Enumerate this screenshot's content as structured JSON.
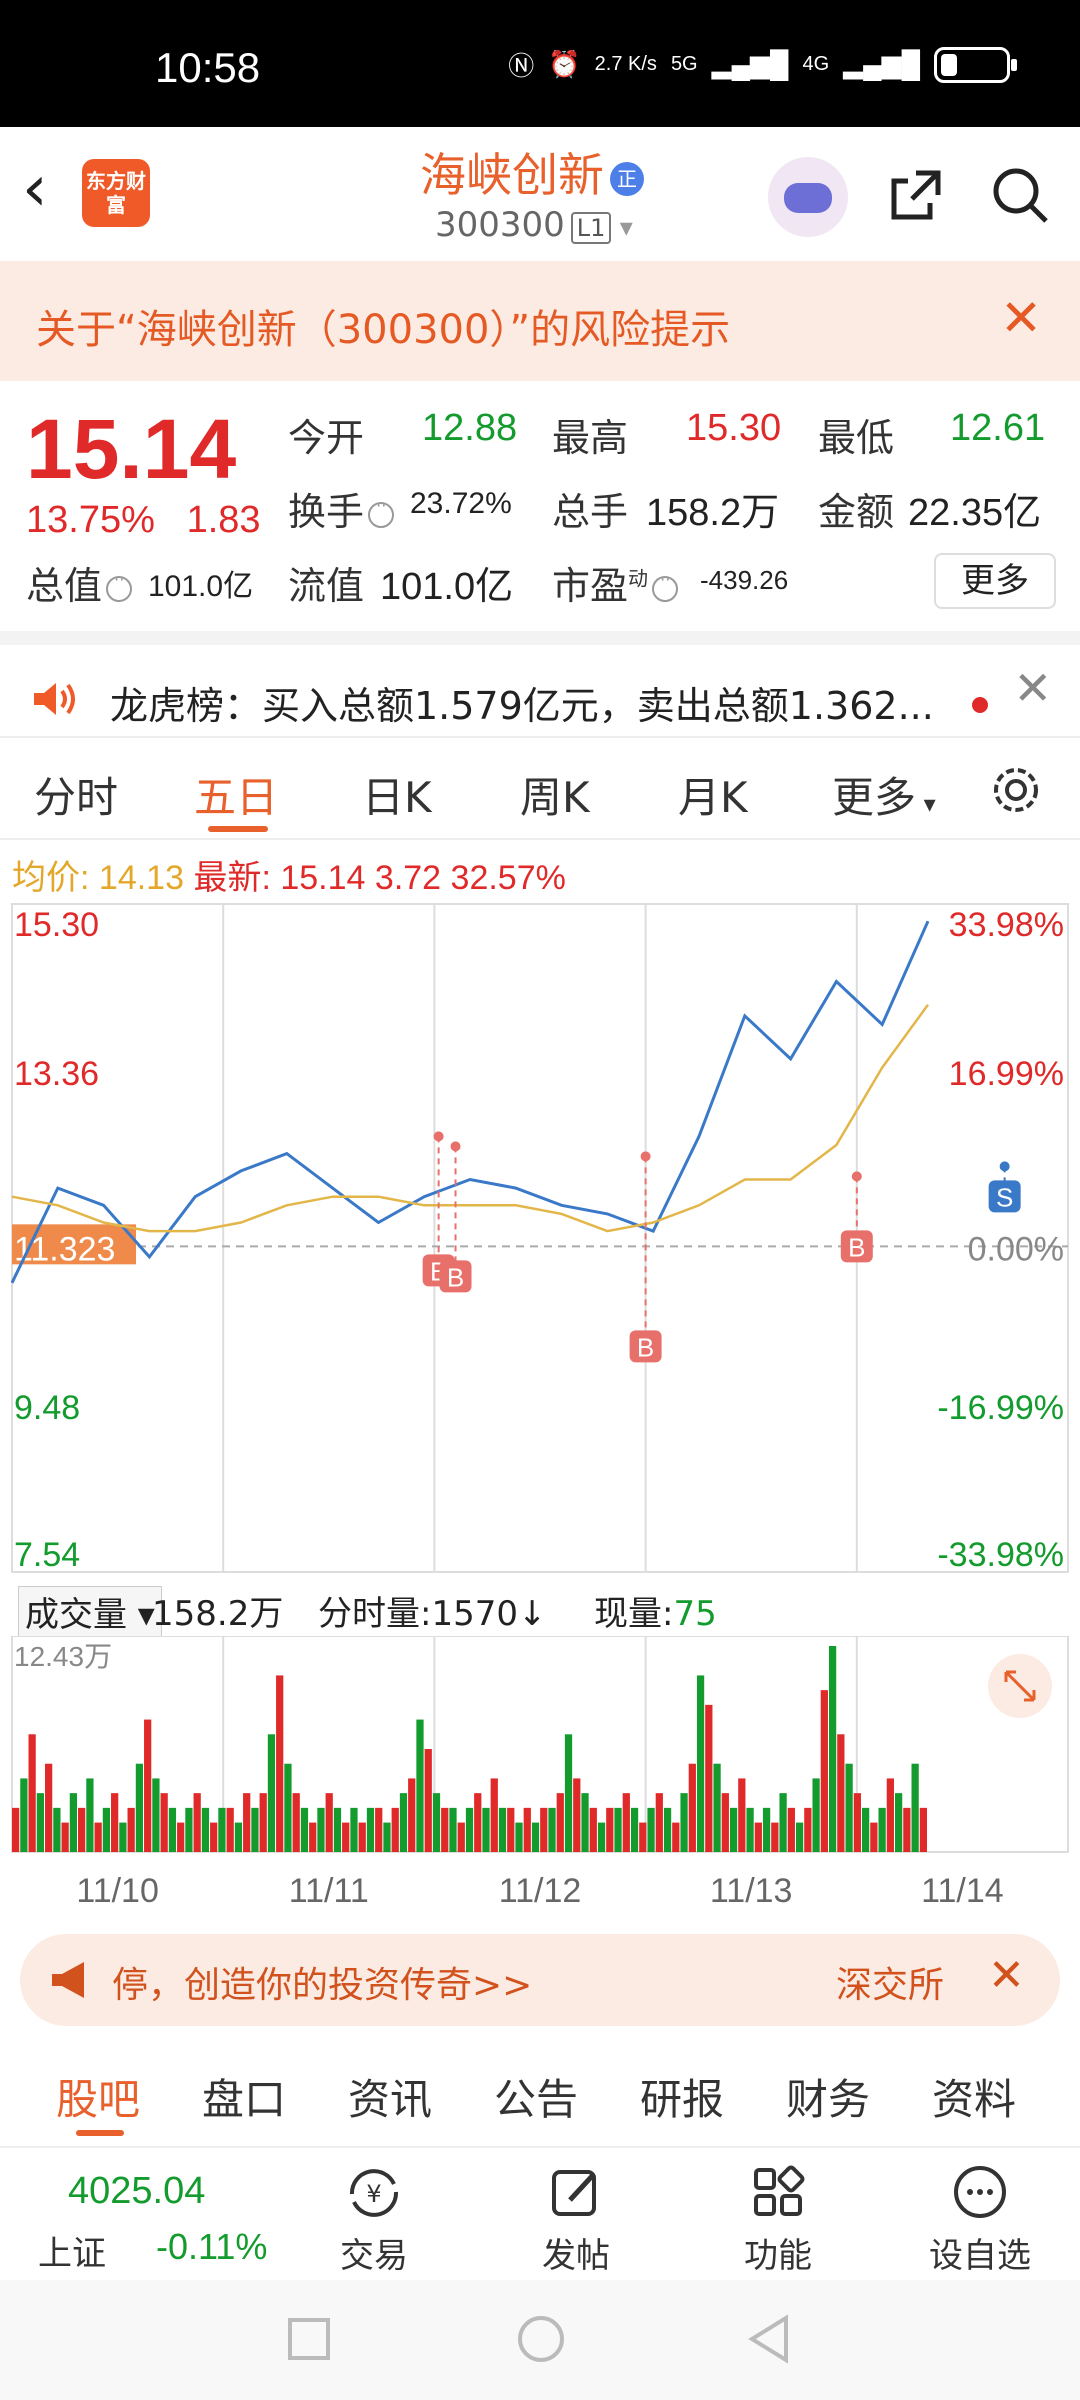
{
  "status_bar": {
    "time": "10:58",
    "net_speed": "2.7 K/s",
    "network1": "5G",
    "network2": "4G"
  },
  "header": {
    "logo_text": "东方财富",
    "stock_name": "海峡创新",
    "badge": "正",
    "stock_code": "300300",
    "level": "L1"
  },
  "risk_notice": {
    "text": "关于“海峡创新（300300）”的风险提示"
  },
  "quote": {
    "price": "15.14",
    "change_pct": "13.75%",
    "change_amt": "1.83",
    "open_label": "今开",
    "open_value": "12.88",
    "high_label": "最高",
    "high_value": "15.30",
    "low_label": "最低",
    "low_value": "12.61",
    "turnover_label": "换手",
    "turnover_value": "23.72%",
    "volume_label": "总手",
    "volume_value": "158.2万",
    "amount_label": "金额",
    "amount_value": "22.35亿",
    "mktcap_label": "总值",
    "mktcap_value": "101.0亿",
    "float_label": "流值",
    "float_value": "101.0亿",
    "pe_label": "市盈",
    "pe_sup": "动",
    "pe_value": "-439.26",
    "more_label": "更多"
  },
  "dragon_tiger": {
    "text": "龙虎榜：买入总额1.579亿元，卖出总额1.362..."
  },
  "chart_tabs": {
    "items": [
      "分时",
      "五日",
      "日K",
      "周K",
      "月K",
      "更多"
    ],
    "active": "五日"
  },
  "legend": {
    "avg_label": "均价:",
    "avg_value": "14.13",
    "latest_label": "最新:",
    "latest_value": "15.14",
    "chg_amt": "3.72",
    "chg_pct": "32.57%"
  },
  "chart_data": {
    "type": "line",
    "x": [
      "11/10",
      "11/11",
      "11/12",
      "11/13",
      "11/14"
    ],
    "y_left_ticks": [
      "15.30",
      "13.36",
      "11.323",
      "9.48",
      "7.54"
    ],
    "y_right_ticks": [
      "33.98%",
      "16.99%",
      "0.00%",
      "-16.99%",
      "-33.98%"
    ],
    "ylim": [
      7.54,
      15.3
    ],
    "base_price": 11.323,
    "series": [
      {
        "name": "最新",
        "values": [
          10.9,
          12.0,
          11.8,
          11.2,
          11.9,
          12.2,
          12.4,
          12.0,
          11.6,
          11.9,
          12.1,
          12.0,
          11.8,
          11.7,
          11.5,
          12.6,
          14.0,
          13.5,
          14.4,
          13.9,
          15.1
        ]
      },
      {
        "name": "均价",
        "values": [
          11.9,
          11.8,
          11.6,
          11.5,
          11.5,
          11.6,
          11.8,
          11.9,
          11.9,
          11.8,
          11.8,
          11.8,
          11.7,
          11.5,
          11.6,
          11.8,
          12.1,
          12.1,
          12.5,
          13.4,
          14.13
        ]
      }
    ],
    "markers": [
      {
        "label": "B",
        "day": "11/11"
      },
      {
        "label": "B",
        "day": "11/11"
      },
      {
        "label": "B",
        "day": "11/12"
      },
      {
        "label": "S",
        "day": "11/13"
      },
      {
        "label": "B",
        "day": "11/13"
      }
    ],
    "grid": true
  },
  "volume": {
    "selector": "成交量",
    "total": "158.2万",
    "minute_label": "分时量:",
    "minute_value": "1570",
    "now_label": "现量:",
    "now_value": "75",
    "max_label": "12.43万",
    "values": [
      3,
      5,
      8,
      4,
      6,
      3,
      2,
      4,
      3,
      5,
      2,
      3,
      4,
      2,
      3,
      6,
      9,
      5,
      4,
      3,
      2,
      3,
      4,
      3,
      2,
      3,
      3,
      2,
      4,
      3,
      4,
      8,
      12,
      6,
      4,
      3,
      2,
      3,
      4,
      3,
      2,
      3,
      2,
      3,
      3,
      2,
      3,
      4,
      5,
      9,
      7,
      4,
      3,
      3,
      2,
      3,
      4,
      3,
      5,
      3,
      3,
      2,
      3,
      2,
      3,
      3,
      4,
      8,
      5,
      4,
      3,
      2,
      3,
      3,
      4,
      3,
      2,
      3,
      4,
      3,
      2,
      4,
      6,
      12,
      10,
      6,
      4,
      3,
      5,
      3,
      2,
      3,
      2,
      4,
      3,
      2,
      3,
      5,
      11,
      14,
      8,
      6,
      4,
      3,
      2,
      3,
      5,
      4,
      3,
      6,
      3
    ]
  },
  "banner": {
    "text": "停，创造你的投资传奇>>",
    "exchange": "深交所"
  },
  "bottom_tabs": {
    "items": [
      "股吧",
      "盘口",
      "资讯",
      "公告",
      "研报",
      "财务",
      "资料"
    ],
    "active": "股吧"
  },
  "nav": {
    "index_value": "4025.04",
    "index_name": "上证",
    "index_change": "-0.11%",
    "items": [
      "交易",
      "发帖",
      "功能",
      "设自选"
    ]
  },
  "colors": {
    "accent": "#e8602c",
    "up": "#e02a2a",
    "down": "#139b2e",
    "price_line": "#3a78c8",
    "avg_line": "#e3b64a"
  }
}
